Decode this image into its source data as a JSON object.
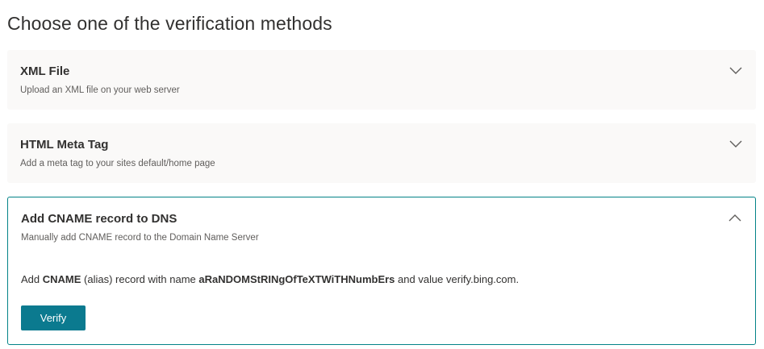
{
  "page": {
    "title": "Choose one of the verification methods"
  },
  "methods": [
    {
      "title": "XML File",
      "subtitle": "Upload an XML file on your web server",
      "state": "collapsed",
      "icon": "chevron-down-icon"
    },
    {
      "title": "HTML Meta Tag",
      "subtitle": "Add a meta tag to your sites default/home page",
      "state": "collapsed",
      "icon": "chevron-down-icon"
    },
    {
      "title": "Add CNAME record to DNS",
      "subtitle": "Manually add CNAME record to the Domain Name Server",
      "state": "expanded",
      "icon": "chevron-up-icon",
      "instruction": {
        "prefix": "Add ",
        "record_type": "CNAME",
        "middle": " (alias) record with name ",
        "record_name": "aRaNDOMStRINgOfTeXTWiTHNumbErs",
        "suffix": " and value verify.bing.com."
      },
      "verify_label": "Verify"
    }
  ],
  "colors": {
    "accent": "#038387",
    "button": "#0b7a8f",
    "card_bg": "#faf9f8",
    "text": "#323130",
    "subtext": "#605e5c"
  }
}
